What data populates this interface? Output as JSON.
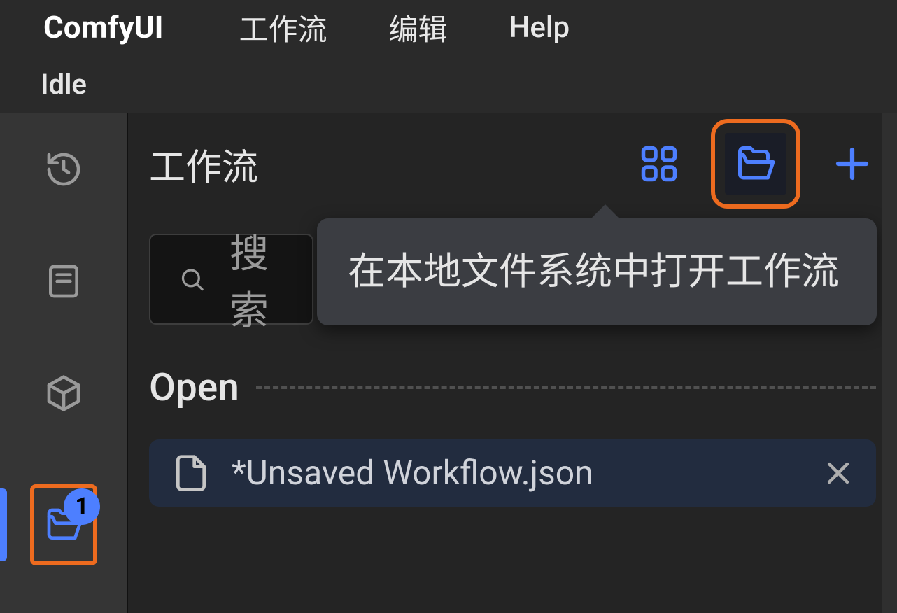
{
  "menubar": {
    "brand": "ComfyUI",
    "items": [
      "工作流",
      "编辑",
      "Help"
    ]
  },
  "status": "Idle",
  "rail": {
    "badge_count": "1"
  },
  "panel": {
    "title": "工作流",
    "tooltip": "在本地文件系统中打开工作流",
    "search_placeholder": "搜索",
    "open_label": "Open",
    "file": {
      "name": "*Unsaved Workflow.json"
    }
  }
}
